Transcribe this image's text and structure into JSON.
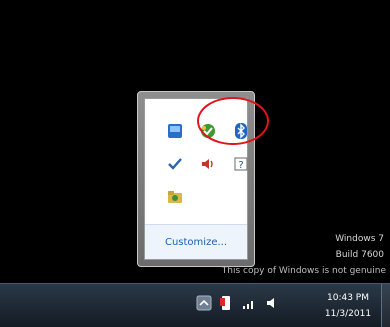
{
  "tray_popup": {
    "icons": [
      {
        "name": "network-center-icon"
      },
      {
        "name": "update-shield-icon"
      },
      {
        "name": "bluetooth-icon"
      },
      {
        "name": "checkmark-icon"
      },
      {
        "name": "speaker-icon"
      },
      {
        "name": "help-icon"
      },
      {
        "name": "folder-app-icon"
      }
    ],
    "customize_label": "Customize..."
  },
  "watermark": {
    "line1": "Windows 7",
    "line2": "Build 7600",
    "line3": "This copy of Windows is not genuine"
  },
  "taskbar": {
    "time": "10:43 PM",
    "date": "11/3/2011"
  },
  "colors": {
    "highlight": "#e0141b",
    "link": "#1f5fae",
    "taskbar": "#1b2631"
  }
}
